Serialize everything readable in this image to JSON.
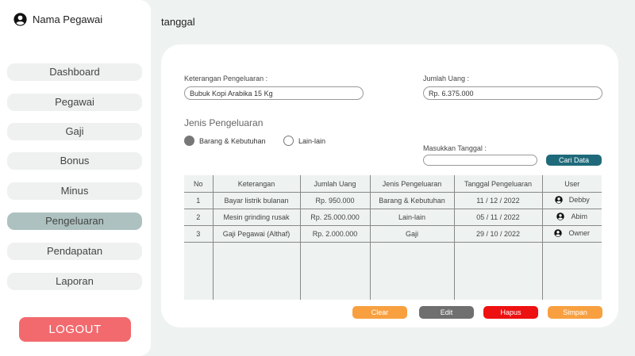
{
  "sidebar": {
    "user_name": "Nama Pegawai",
    "items": [
      {
        "label": "Dashboard"
      },
      {
        "label": "Pegawai"
      },
      {
        "label": "Gaji"
      },
      {
        "label": "Bonus"
      },
      {
        "label": "Minus"
      },
      {
        "label": "Pengeluaran"
      },
      {
        "label": "Pendapatan"
      },
      {
        "label": "Laporan"
      }
    ],
    "active_item": "Pengeluaran",
    "logout_label": "LOGOUT"
  },
  "header": {
    "title": "tanggal"
  },
  "form": {
    "keterangan_label": "Keterangan Pengeluaran :",
    "keterangan_value": "Bubuk Kopi Arabika 15 Kg",
    "jumlah_label": "Jumlah Uang :",
    "jumlah_value": "Rp. 6.375.000",
    "jenis_title": "Jenis Pengeluaran",
    "radio_options": [
      {
        "label": "Barang & Kebutuhan",
        "selected": true
      },
      {
        "label": "Lain-lain",
        "selected": false
      }
    ],
    "tanggal_label": "Masukkan Tanggal :",
    "tanggal_value": "",
    "cari_label": "Cari Data"
  },
  "table": {
    "headers": [
      "No",
      "Keterangan",
      "Jumlah Uang",
      "Jenis Pengeluaran",
      "Tanggal Pengeluaran",
      "User"
    ],
    "rows": [
      [
        "1",
        "Bayar listrik bulanan",
        "Rp. 950.000",
        "Barang & Kebutuhan",
        "11 / 12 / 2022",
        "Debby"
      ],
      [
        "2",
        "Mesin grinding rusak",
        "Rp. 25.000.000",
        "Lain-lain",
        "05 / 11 / 2022",
        "Abim"
      ],
      [
        "3",
        "Gaji Pegawai (Althaf)",
        "Rp. 2.000.000",
        "Gaji",
        "29 / 10 / 2022",
        "Owner"
      ]
    ]
  },
  "actions": [
    {
      "label": "Clear",
      "color": "#f8a040"
    },
    {
      "label": "Edit",
      "color": "#6f6f6f"
    },
    {
      "label": "Hapus",
      "color": "#ee1111"
    },
    {
      "label": "Simpan",
      "color": "#f8a040"
    }
  ],
  "colors": {
    "background": "#eef2f1",
    "active_nav": "#adc2c0",
    "logout": "#f26a6e",
    "cari_button": "#1e6a7a"
  }
}
